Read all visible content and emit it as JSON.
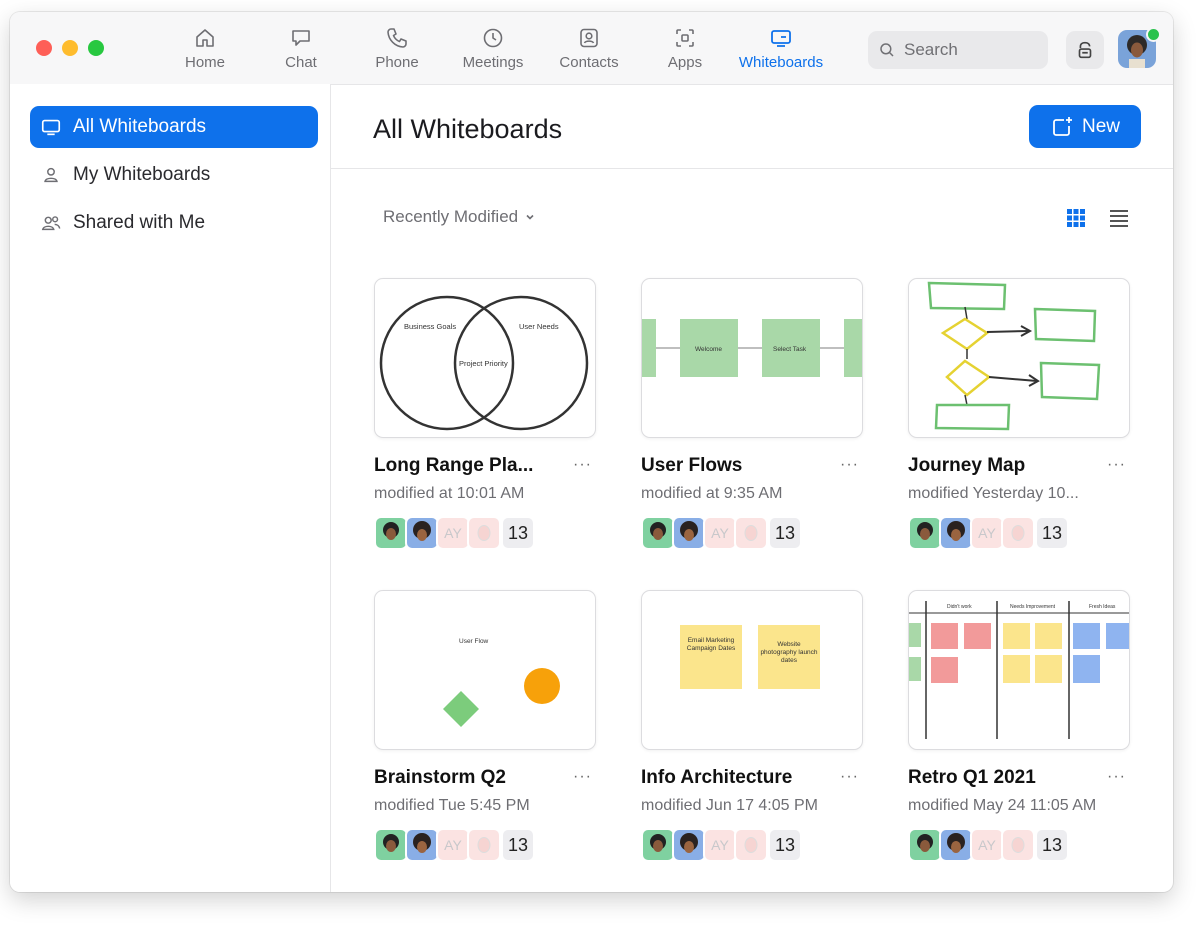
{
  "nav": {
    "items": [
      {
        "label": "Home",
        "icon": "home-icon"
      },
      {
        "label": "Chat",
        "icon": "chat-icon"
      },
      {
        "label": "Phone",
        "icon": "phone-icon"
      },
      {
        "label": "Meetings",
        "icon": "clock-icon"
      },
      {
        "label": "Contacts",
        "icon": "contacts-icon"
      },
      {
        "label": "Apps",
        "icon": "apps-icon"
      },
      {
        "label": "Whiteboards",
        "icon": "whiteboard-icon",
        "active": true
      }
    ],
    "search_placeholder": "Search",
    "accent": "#0e71eb"
  },
  "sidebar": {
    "items": [
      {
        "label": "All Whiteboards",
        "icon": "whiteboard-icon",
        "active": true
      },
      {
        "label": "My Whiteboards",
        "icon": "person-icon"
      },
      {
        "label": "Shared with Me",
        "icon": "people-icon"
      }
    ]
  },
  "main": {
    "title": "All Whiteboards",
    "new_label": "New",
    "sort_label": "Recently Modified",
    "cards": [
      {
        "title": "Long Range Pla...",
        "meta": "modified at 10:01 AM",
        "count": "13",
        "initials": "AY",
        "thumb": "venn",
        "thumb_text": [
          "Business Goals",
          "User Needs",
          "Project Priority"
        ]
      },
      {
        "title": "User Flows",
        "meta": "modified at 9:35 AM",
        "count": "13",
        "initials": "AY",
        "thumb": "flow",
        "thumb_text": [
          "Welcome",
          "Select Task"
        ]
      },
      {
        "title": "Journey Map",
        "meta": "modified Yesterday 10...",
        "count": "13",
        "initials": "AY",
        "thumb": "journey",
        "thumb_text": []
      },
      {
        "title": "Brainstorm Q2",
        "meta": "modified Tue 5:45 PM",
        "count": "13",
        "initials": "AY",
        "thumb": "brainstorm",
        "thumb_text": [
          "User Flow"
        ]
      },
      {
        "title": "Info Architecture",
        "meta": "modified Jun 17 4:05 PM",
        "count": "13",
        "initials": "AY",
        "thumb": "stickies",
        "thumb_text": [
          "Email Marketing Campaign Dates",
          "Website photography launch dates"
        ]
      },
      {
        "title": "Retro Q1 2021",
        "meta": "modified May 24 11:05 AM",
        "count": "13",
        "initials": "AY",
        "thumb": "retro",
        "thumb_text": [
          "Didn't work",
          "Needs Improvement",
          "Fresh Ideas"
        ]
      }
    ]
  }
}
